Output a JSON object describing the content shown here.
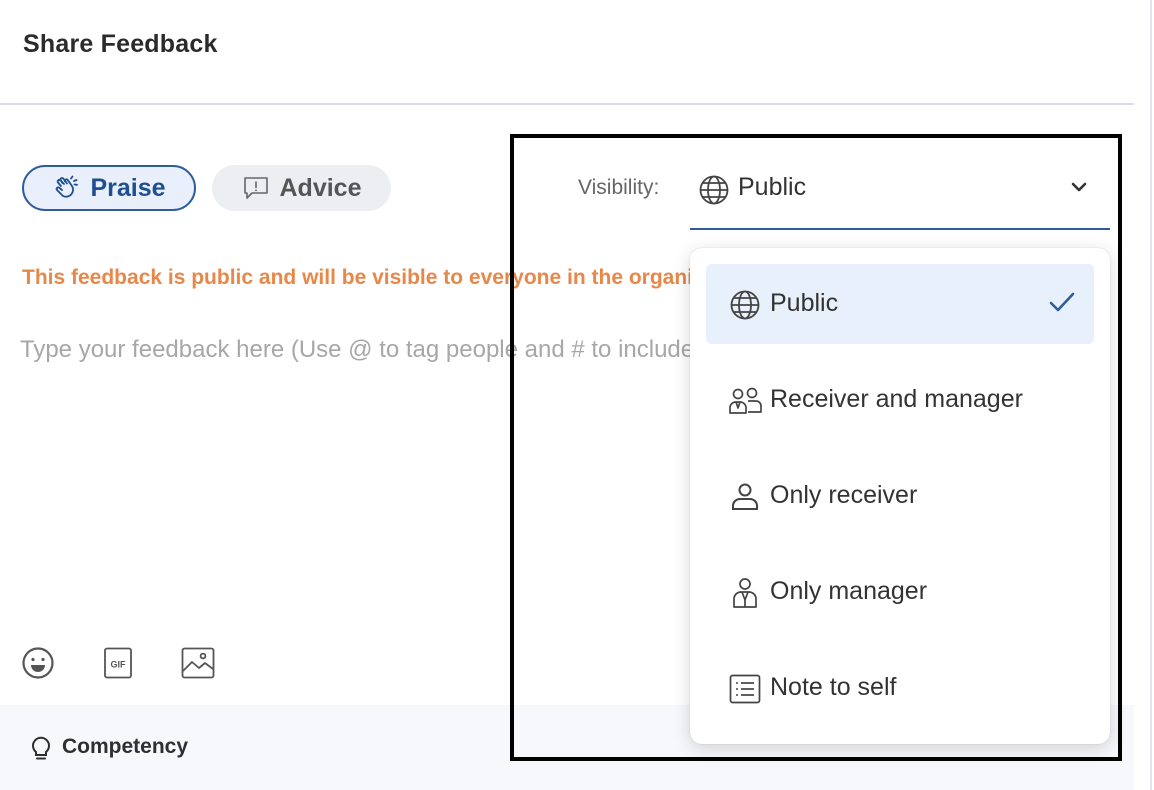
{
  "header": {
    "title": "Share Feedback"
  },
  "feedback_type": {
    "selected": "Praise",
    "options": [
      {
        "label": "Praise",
        "icon": "clapping-hands-icon"
      },
      {
        "label": "Advice",
        "icon": "exclamation-bubble-icon"
      }
    ]
  },
  "notice": {
    "text": "This feedback is public and will be visible to everyone in the organization."
  },
  "editor": {
    "placeholder": "Type your feedback here (Use @ to tag people and # to include competencies)",
    "value": ""
  },
  "toolbar": {
    "icons": [
      "emoji-icon",
      "gif-icon",
      "image-icon"
    ]
  },
  "competency": {
    "label": "Competency",
    "icon": "lightbulb-icon"
  },
  "visibility": {
    "label": "Visibility:",
    "selected": "Public",
    "options": [
      {
        "label": "Public",
        "icon": "globe-icon",
        "selected": true
      },
      {
        "label": "Receiver and manager",
        "icon": "people-icon",
        "selected": false
      },
      {
        "label": "Only receiver",
        "icon": "person-icon",
        "selected": false
      },
      {
        "label": "Only manager",
        "icon": "manager-icon",
        "selected": false
      },
      {
        "label": "Note to self",
        "icon": "note-icon",
        "selected": false
      }
    ]
  },
  "colors": {
    "accent": "#2f5d9c",
    "notice": "#e8874a",
    "selected_bg": "#e8f0fb"
  }
}
